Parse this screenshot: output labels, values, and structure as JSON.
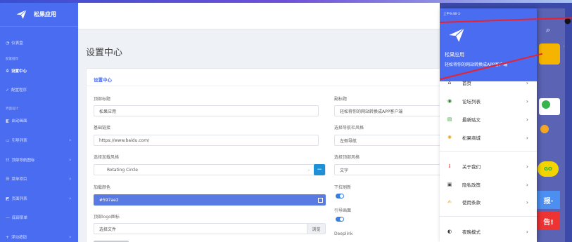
{
  "sidebar": {
    "brand": "松果应用",
    "items": [
      {
        "label": "仪表盘",
        "icon": "dashboard-icon"
      },
      {
        "section": "配置推荐"
      },
      {
        "label": "设置中心",
        "icon": "gear-icon",
        "active": true
      },
      {
        "label": "配置程序",
        "icon": "check-icon"
      },
      {
        "section": "界面设计"
      },
      {
        "label": "启动画面",
        "icon": "image-icon"
      },
      {
        "label": "引导列表",
        "icon": "guide-icon",
        "arrow": true
      },
      {
        "label": "顶部导航图标",
        "icon": "nav-icon",
        "arrow": true
      },
      {
        "label": "菜单项目",
        "icon": "menu-icon",
        "arrow": true
      },
      {
        "label": "页面列表",
        "icon": "page-icon",
        "arrow": true
      },
      {
        "label": "底部菜单",
        "icon": "bottom-menu-icon"
      },
      {
        "label": "浮动按钮",
        "icon": "float-icon",
        "arrow": true
      }
    ]
  },
  "page": {
    "title": "设置中心"
  },
  "card": {
    "title": "设置中心",
    "fields": {
      "top_title_label": "顶部标题",
      "top_title_value": "松果应用",
      "subtitle_label": "副标题",
      "subtitle_value": "轻松将你的网站转换成APP客户端",
      "base_url_label": "基础链接",
      "base_url_value": "https://www.baidu.com/",
      "nav_style_label": "选择导航栏风格",
      "nav_style_value": "左侧导航",
      "loading_style_label": "选择加载风格",
      "loading_style_value": "Rotating Circle",
      "top_style_label": "选择顶部风格",
      "top_style_value": "文字",
      "loading_color_label": "加载颜色",
      "loading_color_value": "#597ae2",
      "pull_refresh_label": "下拉刷新",
      "guide_label": "引导画面",
      "logo_label": "顶部logo图标",
      "logo_placeholder": "选择文件",
      "browse_label": "浏览",
      "deeplink_label": "Deeplink"
    }
  },
  "phone": {
    "status": "上午9:48 ①",
    "app_name": "松果应用",
    "app_sub": "轻松将你的网站转换成APP客户端",
    "menu": [
      {
        "label": "首页",
        "icon": "home-icon",
        "icon_char": "⌂",
        "color": "#333"
      },
      {
        "label": "论坛列表",
        "icon": "forum-icon",
        "icon_char": "◉",
        "color": "#2a7d2a"
      },
      {
        "label": "最新贴文",
        "icon": "post-icon",
        "icon_char": "▤",
        "color": "#3aa33a"
      },
      {
        "label": "松果商城",
        "icon": "shop-icon",
        "icon_char": "✺",
        "color": "#e8a316"
      },
      {
        "label": "关于我们",
        "icon": "info-icon",
        "icon_char": "ℹ",
        "color": "#e05050"
      },
      {
        "label": "隐私政策",
        "icon": "privacy-icon",
        "icon_char": "▣",
        "color": "#444"
      },
      {
        "label": "使用条款",
        "icon": "terms-icon",
        "icon_char": "✍",
        "color": "#e8a316"
      },
      {
        "label": "夜晚模式",
        "icon": "moon-icon",
        "icon_char": "◐",
        "color": "#333"
      }
    ],
    "side_go": "GO",
    "side_banner1": "报·",
    "side_banner2": "告!"
  }
}
